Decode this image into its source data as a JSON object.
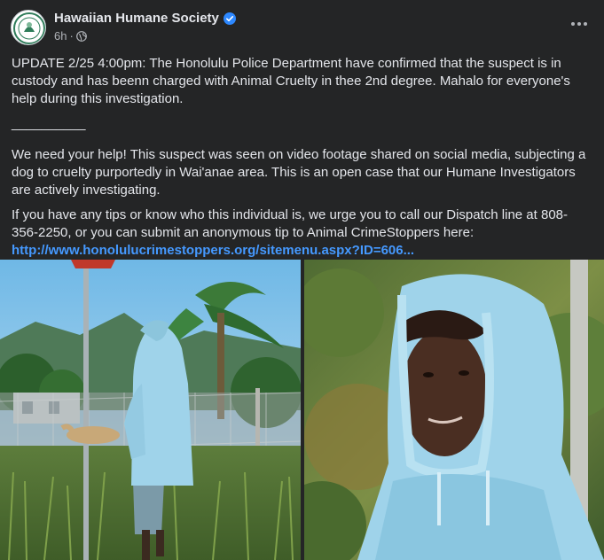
{
  "header": {
    "page_name": "Hawaiian Humane Society",
    "timestamp": "6h",
    "separator": "·",
    "verified": true,
    "privacy": "public-globe-icon"
  },
  "post": {
    "paragraphs": [
      "UPDATE 2/25 4:00pm: The Honolulu Police Department have confirmed that the suspect is in custody and has beenn charged with Animal Cruelty in thee 2nd degree. Mahalo for everyone's help during this investigation.",
      "__________",
      "We need your help! This suspect was seen on video footage shared on social media, subjecting a dog to cruelty purportedly in Wai'anae area. This is an open case that our Humane Investigators are actively investigating.",
      "If you have any tips or know who this individual is, we urge you to call our Dispatch line at 808-356-2250, or you can submit an anonymous tip to Animal CrimeStoppers here:"
    ],
    "link": "http://www.honolulucrimestoppers.org/sitemenu.aspx?ID=606..."
  },
  "colors": {
    "background": "#242526",
    "text": "#e4e6eb",
    "secondary_text": "#b0b3b8",
    "link": "#4599ff",
    "verified_badge": "#2d88ff",
    "hoodie": "#9fd3ea"
  }
}
